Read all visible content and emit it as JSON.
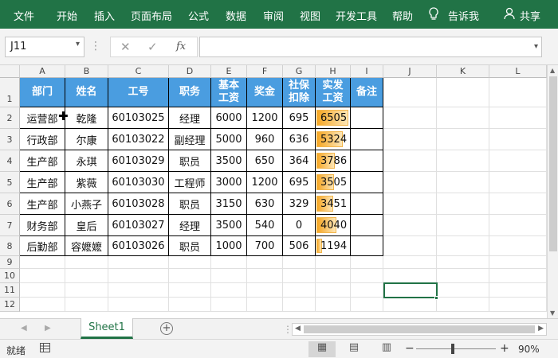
{
  "ribbon": {
    "tabs": [
      "文件",
      "开始",
      "插入",
      "页面布局",
      "公式",
      "数据",
      "审阅",
      "视图",
      "开发工具",
      "帮助"
    ],
    "tell_me": "告诉我",
    "share": "共享",
    "accent": "#217346"
  },
  "formula_bar": {
    "name_box": "J11",
    "cancel_icon": "x-icon",
    "enter_icon": "check-icon",
    "function_icon": "fx-icon",
    "formula": ""
  },
  "columns": [
    "A",
    "B",
    "C",
    "D",
    "E",
    "F",
    "G",
    "H",
    "I",
    "J",
    "K",
    "L"
  ],
  "rows": [
    "1",
    "2",
    "3",
    "4",
    "5",
    "6",
    "7",
    "8",
    "9",
    "10",
    "11",
    "12"
  ],
  "table": {
    "header_color": "#4a9de0",
    "headers": [
      "部门",
      "姓名",
      "工号",
      "职务",
      "基本工资",
      "奖金",
      "社保扣除",
      "实发工资",
      "备注"
    ],
    "header_display": [
      [
        "部门"
      ],
      [
        "姓名"
      ],
      [
        "工号"
      ],
      [
        "职务"
      ],
      [
        "基本",
        "工资"
      ],
      [
        "奖金"
      ],
      [
        "社保",
        "扣除"
      ],
      [
        "实发",
        "工资"
      ],
      [
        "备注"
      ]
    ],
    "rows": [
      [
        "运营部",
        "乾隆",
        "60103025",
        "经理",
        "6000",
        "1200",
        "695",
        "6505",
        ""
      ],
      [
        "行政部",
        "尔康",
        "60103022",
        "副经理",
        "5000",
        "960",
        "636",
        "5324",
        ""
      ],
      [
        "生产部",
        "永琪",
        "60103029",
        "职员",
        "3500",
        "650",
        "364",
        "3786",
        ""
      ],
      [
        "生产部",
        "紫薇",
        "60103030",
        "工程师",
        "3000",
        "1200",
        "695",
        "3505",
        ""
      ],
      [
        "生产部",
        "小燕子",
        "60103028",
        "职员",
        "3150",
        "630",
        "329",
        "3451",
        ""
      ],
      [
        "财务部",
        "皇后",
        "60103027",
        "经理",
        "3500",
        "540",
        "0",
        "4040",
        ""
      ],
      [
        "后勤部",
        "容嬷嬷",
        "60103026",
        "职员",
        "1000",
        "700",
        "506",
        "1194",
        ""
      ]
    ],
    "databar_color": "#f6a623",
    "databar_max": 6505
  },
  "selected_cell": "J11",
  "sheet_tabs": [
    "Sheet1"
  ],
  "status": {
    "ready": "就绪",
    "zoom": "90%"
  }
}
